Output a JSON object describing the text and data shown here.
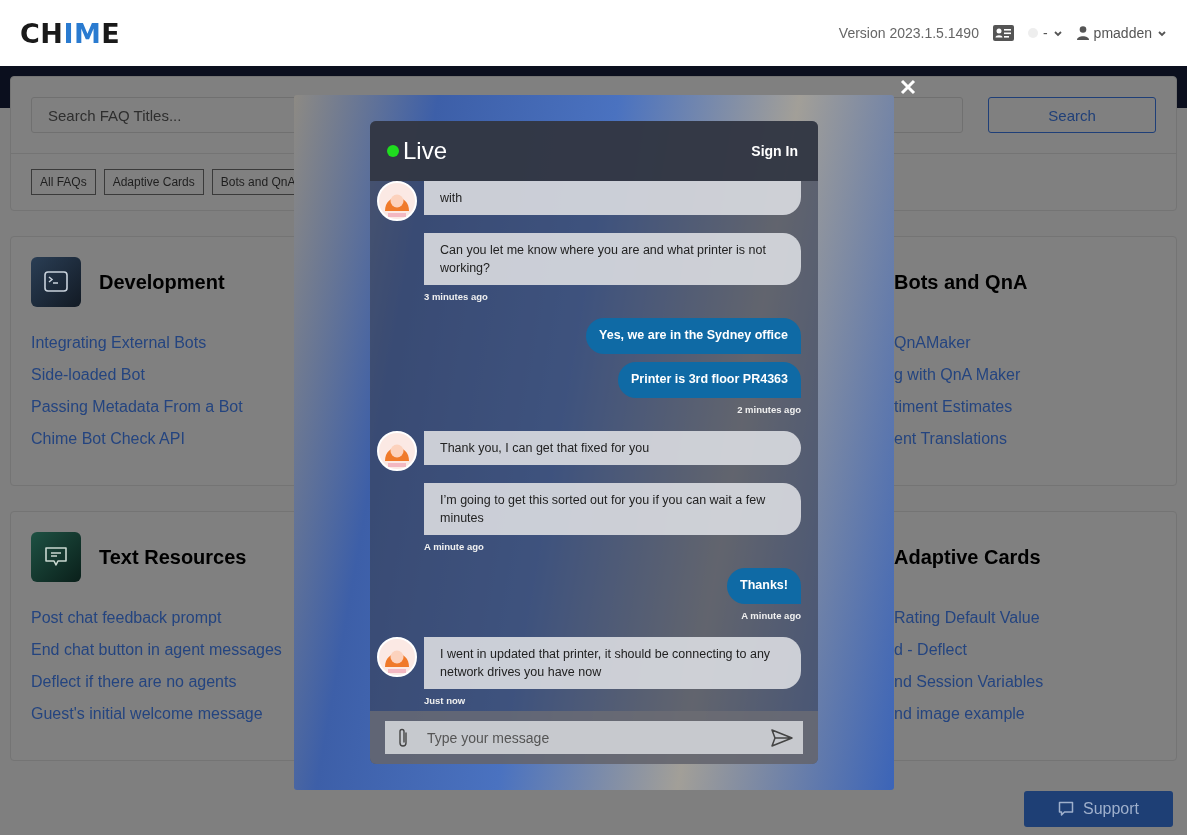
{
  "header": {
    "logo": [
      {
        "text": "CH",
        "accent": false
      },
      {
        "text": "IM",
        "accent": true
      },
      {
        "text": "E",
        "accent": false
      }
    ],
    "version": "Version 2023.1.5.1490",
    "status_menu": {
      "label": "-"
    },
    "user_menu": {
      "label": "pmadden"
    }
  },
  "search": {
    "placeholder": "Search FAQ Titles...",
    "button": "Search"
  },
  "filters": [
    "All FAQs",
    "Adaptive Cards",
    "Bots and QnA"
  ],
  "category_rows": [
    {
      "left": {
        "title": "Development",
        "links": [
          "Integrating External Bots",
          "Side-loaded Bot",
          "Passing Metadata From a Bot",
          "Chime Bot Check API"
        ]
      },
      "right": {
        "title": "Bots and QnA",
        "links": [
          "QnAMaker",
          "g with QnA Maker",
          "timent Estimates",
          "ent Translations"
        ]
      }
    },
    {
      "left": {
        "title": "Text Resources",
        "links": [
          "Post chat feedback prompt",
          "End chat button in agent messages",
          "Deflect if there are no agents",
          "Guest's initial welcome message"
        ]
      },
      "right": {
        "title": "Adaptive Cards",
        "links": [
          "Rating Default Value",
          "d - Deflect",
          "nd Session Variables",
          "nd image example"
        ]
      }
    }
  ],
  "chat": {
    "status": "Live",
    "online": true,
    "sign_in": "Sign In",
    "messages": [
      {
        "kind": "agent",
        "avatar": true,
        "text": "with"
      },
      {
        "kind": "agent",
        "avatar": false,
        "text": "Can you let me know where you are and what printer is not working?"
      },
      {
        "kind": "time",
        "text": "3 minutes ago"
      },
      {
        "kind": "user",
        "text": "Yes, we are in the Sydney office"
      },
      {
        "kind": "user",
        "text": "Printer is 3rd floor PR4363"
      },
      {
        "kind": "time",
        "text": "2 minutes ago"
      },
      {
        "kind": "agent",
        "avatar": true,
        "text": "Thank you, I can get that fixed for you"
      },
      {
        "kind": "agent",
        "avatar": false,
        "text": "I’m going to get this sorted out for you if you can wait a few minutes"
      },
      {
        "kind": "time",
        "text": "A minute ago"
      },
      {
        "kind": "user",
        "text": "Thanks!"
      },
      {
        "kind": "time",
        "text": "A minute ago"
      },
      {
        "kind": "agent",
        "avatar": true,
        "text": "I went in updated that printer, it should be connecting to any network drives you have now"
      },
      {
        "kind": "time",
        "text": "Just now"
      }
    ],
    "input": {
      "placeholder": "Type your message"
    }
  },
  "support_button": "Support"
}
